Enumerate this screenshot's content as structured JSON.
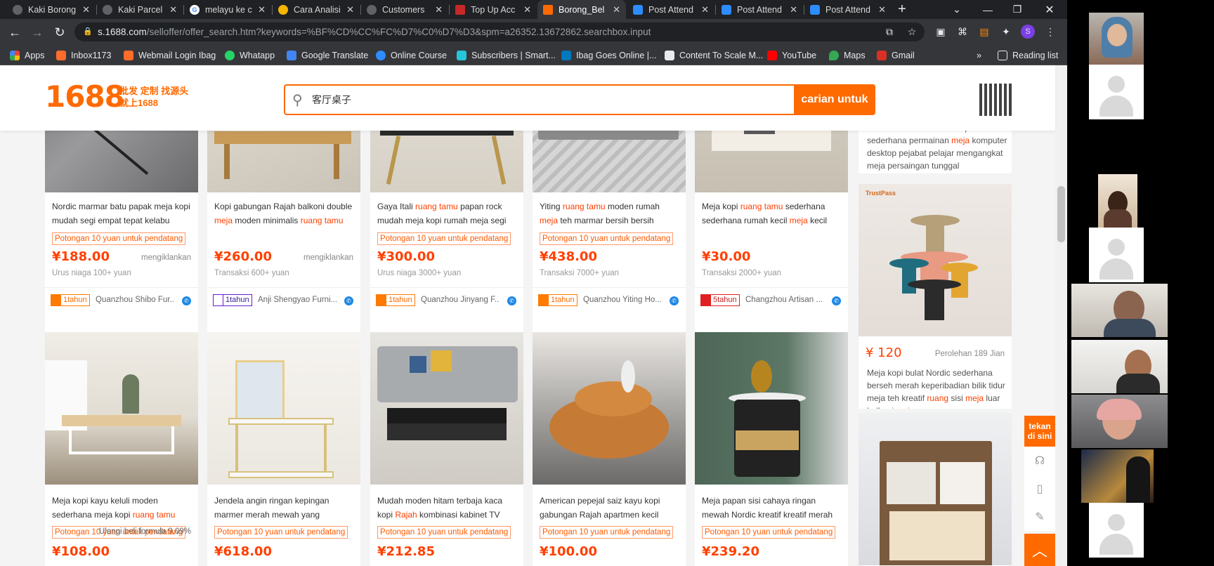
{
  "tabs": [
    {
      "title": "Kaki Borong",
      "icon": "app-circle-icon",
      "color": "#5f6368"
    },
    {
      "title": "Kaki Parcel",
      "icon": "app-circle-icon",
      "color": "#5f6368"
    },
    {
      "title": "melayu ke c",
      "icon": "google-g-icon",
      "color": "#4285f4"
    },
    {
      "title": "Cara Analisi",
      "icon": "blog-icon",
      "color": "#f4b400"
    },
    {
      "title": "Customers",
      "icon": "app-circle-icon",
      "color": "#5f6368"
    },
    {
      "title": "Top Up Acc",
      "icon": "shop-icon",
      "color": "#c62828"
    },
    {
      "title": "Borong_Bel",
      "icon": "1688-icon",
      "color": "#ff6a00"
    },
    {
      "title": "Post Attend",
      "icon": "zoom-icon",
      "color": "#2d8cff"
    },
    {
      "title": "Post Attend",
      "icon": "zoom-icon",
      "color": "#2d8cff"
    },
    {
      "title": "Post Attend",
      "icon": "zoom-icon",
      "color": "#2d8cff"
    }
  ],
  "address": {
    "domain": "s.1688.com",
    "path": "/selloffer/offer_search.htm?keywords=%BF%CD%CC%FC%D7%C0%D7%D3&spm=a26352.13672862.searchbox.input"
  },
  "bookmarks": [
    {
      "label": "Apps",
      "icon": "apps-grid-icon",
      "color": "#ea4335"
    },
    {
      "label": "Inbox1173",
      "icon": "cpanel-icon",
      "color": "#ff6c2c"
    },
    {
      "label": "Webmail Login Ibag",
      "icon": "cpanel-icon",
      "color": "#ff6c2c"
    },
    {
      "label": "Whatapp",
      "icon": "whatsapp-icon",
      "color": "#25d366"
    },
    {
      "label": "Google Translate",
      "icon": "translate-icon",
      "color": "#4285f4"
    },
    {
      "label": "Online Course",
      "icon": "zoom-icon",
      "color": "#2d8cff"
    },
    {
      "label": "Subscribers | Smart...",
      "icon": "subscribers-icon",
      "color": "#26c6da"
    },
    {
      "label": "Ibag Goes Online |...",
      "icon": "trello-icon",
      "color": "#0079bf"
    },
    {
      "label": "Content To Scale M...",
      "icon": "content-icon",
      "color": "#e8eaed"
    },
    {
      "label": "YouTube",
      "icon": "youtube-icon",
      "color": "#ff0000"
    },
    {
      "label": "Maps",
      "icon": "maps-pin-icon",
      "color": "#34a853"
    },
    {
      "label": "Gmail",
      "icon": "gmail-icon",
      "color": "#d93025"
    }
  ],
  "reading_list": "Reading list",
  "site": {
    "logo": "1688",
    "slogan_line1": "批发 定制 找源头",
    "slogan_line2": "就上1688",
    "search_value": "客厅桌子",
    "search_button": "carian untuk"
  },
  "products": [
    {
      "title_parts": [
        {
          "t": "Nordic marmar batu papak meja kopi mudah segi empat tepat kelabu",
          "h": false
        }
      ],
      "promo": "Potongan 10 yuan untuk pendatang",
      "price": "¥188.00",
      "ad": "mengiklankan",
      "sub": "Urus niaga 100+ yuan",
      "years": "1tahun",
      "badge": "orange",
      "seller": "Quanzhou Shibo Fur..."
    },
    {
      "title_parts": [
        {
          "t": "Kopi gabungan Rajah balkoni double ",
          "h": false
        },
        {
          "t": "meja",
          "h": true
        },
        {
          "t": " moden minimalis ",
          "h": false
        },
        {
          "t": "ruang tamu",
          "h": true
        }
      ],
      "promo": "",
      "price": "¥260.00",
      "ad": "mengiklankan",
      "sub": "Transaksi 600+ yuan",
      "years": "1tahun",
      "badge": "purple",
      "seller": "Anji Shengyao Furni..."
    },
    {
      "title_parts": [
        {
          "t": "Gaya Itali ",
          "h": false
        },
        {
          "t": "ruang tamu",
          "h": true
        },
        {
          "t": " papan rock mudah meja kopi rumah meja segi",
          "h": false
        }
      ],
      "promo": "Potongan 10 yuan untuk pendatang",
      "price": "¥300.00",
      "ad": "",
      "sub": "Urus niaga 3000+ yuan",
      "years": "1tahun",
      "badge": "orange",
      "seller": "Quanzhou Jinyang F..."
    },
    {
      "title_parts": [
        {
          "t": "Yiting ",
          "h": false
        },
        {
          "t": "ruang tamu",
          "h": true
        },
        {
          "t": " moden rumah ",
          "h": false
        },
        {
          "t": "meja",
          "h": true
        },
        {
          "t": " teh marmar bersih bersih",
          "h": false
        }
      ],
      "promo": "Potongan 10 yuan untuk pendatang",
      "price": "¥438.00",
      "ad": "",
      "sub": "Transaksi 7000+ yuan",
      "years": "1tahun",
      "badge": "orange",
      "seller": "Quanzhou Yiting Ho..."
    },
    {
      "title_parts": [
        {
          "t": "Meja kopi ",
          "h": false
        },
        {
          "t": "ruang tamu",
          "h": true
        },
        {
          "t": " sederhana sederhana rumah kecil ",
          "h": false
        },
        {
          "t": "meja",
          "h": true
        },
        {
          "t": " kecil",
          "h": false
        }
      ],
      "promo": "",
      "price": "¥30.00",
      "ad": "",
      "sub": "Transaksi 2000+ yuan",
      "years": "5tahun",
      "badge": "red",
      "seller": "Changzhou Artisan ..."
    },
    {
      "title_parts": [
        {
          "t": "Meja kopi kayu keluli moden sederhana meja kopi ",
          "h": false
        },
        {
          "t": "ruang tamu",
          "h": true
        }
      ],
      "promo": "Potongan 10 yuan untuk pendatang",
      "promo_extra": "Ulangi beli formula 9.09%",
      "price": "¥108.00",
      "ad": "",
      "sub": "",
      "years": "",
      "badge": "",
      "seller": ""
    },
    {
      "title_parts": [
        {
          "t": "Jendela angin ringan kepingan marmer merah mewah yang",
          "h": false
        }
      ],
      "promo": "Potongan 10 yuan untuk pendatang",
      "price": "¥618.00",
      "ad": "",
      "sub": "",
      "years": "",
      "badge": "",
      "seller": ""
    },
    {
      "title_parts": [
        {
          "t": "Mudah moden hitam terbaja kaca kopi ",
          "h": false
        },
        {
          "t": "Rajah",
          "h": true
        },
        {
          "t": " kombinasi kabinet TV",
          "h": false
        }
      ],
      "promo": "Potongan 10 yuan untuk pendatang",
      "price": "¥212.85",
      "ad": "",
      "sub": "",
      "years": "",
      "badge": "",
      "seller": ""
    },
    {
      "title_parts": [
        {
          "t": "American pepejal saiz kayu kopi gabungan Rajah apartmen kecil",
          "h": false
        }
      ],
      "promo": "Potongan 10 yuan untuk pendatang",
      "price": "¥100.00",
      "ad": "",
      "sub": "",
      "years": "",
      "badge": "",
      "seller": ""
    },
    {
      "title_parts": [
        {
          "t": "Meja papan sisi cahaya ringan mewah Nordic kreatif kreatif merah",
          "h": false
        }
      ],
      "promo": "Potongan 10 yuan untuk pendatang",
      "price": "¥239.20",
      "ad": "",
      "sub": "",
      "years": "",
      "badge": "",
      "seller": ""
    }
  ],
  "side": {
    "top_text_parts": [
      {
        "t": "Internet cafe hantu warna permainan sederhana permainan ",
        "h": false
      },
      {
        "t": "meja",
        "h": true
      },
      {
        "t": " komputer desktop pejabat pelajar mengangkat meja persaingan tunggal",
        "h": false
      }
    ],
    "price": "¥ 120",
    "acquired": "Perolehan 189 Jian",
    "desc_parts": [
      {
        "t": "Meja kopi bulat Nordic sederhana berseh merah keperibadian bilik tidur meja teh kreatif ",
        "h": false
      },
      {
        "t": "ruang",
        "h": true
      },
      {
        "t": " sisi ",
        "h": false
      },
      {
        "t": "meja",
        "h": true
      },
      {
        "t": " luar balkoni ",
        "h": false
      },
      {
        "t": "meja",
        "h": true
      }
    ],
    "trustpass": "TrustPass"
  },
  "float_help": "tekan di sini"
}
